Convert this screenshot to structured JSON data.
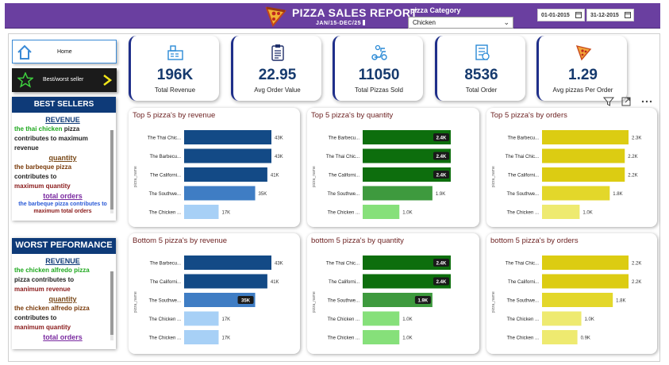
{
  "header": {
    "title": "PIZZA SALES REPORT",
    "subtitle": "JAN/15-DEC/25",
    "category_label": "pizza Category",
    "category_value": "Chicken",
    "date_start": "01-01-2015",
    "date_end": "31-12-2015"
  },
  "nav": {
    "home_label": "Home",
    "best_worst_label": "Best/worst seller"
  },
  "best_sellers": {
    "title": "BEST SELLERS",
    "revenue_title": "REVENUE",
    "revenue_l1": "the thai chicken",
    "revenue_l1b": " pizza",
    "revenue_l2": "contributes to maximum",
    "revenue_l3": "revenue",
    "quantity_title": "quantity",
    "quantity_l1": "the barbeque pizza",
    "quantity_l2": "contributes to",
    "quantity_l3": "maximum quantity",
    "orders_title": "total orders",
    "orders_l1": "the barbeque pizza contributes to",
    "orders_l2": "maximum total orders"
  },
  "worst": {
    "title": "WORST PEFORMANCE",
    "revenue_title": "REVENUE",
    "revenue_l1": "the chicken alfredo pizza",
    "revenue_l2": "pizza contributes to",
    "revenue_l3": "manimum revenue",
    "quantity_title": "quantity",
    "quantity_l1": "the chicken alfredo pizza",
    "quantity_l2": "contributes to",
    "quantity_l3": "manimum quantity",
    "orders_title": "total orders"
  },
  "kpis": [
    {
      "value": "196K",
      "label": "Total Revenue",
      "icon": "cash-register-icon"
    },
    {
      "value": "22.95",
      "label": "Avg Order Value",
      "icon": "clipboard-icon"
    },
    {
      "value": "11050",
      "label": "Total Pizzas Sold",
      "icon": "delivery-scooter-icon"
    },
    {
      "value": "8536",
      "label": "Total Order",
      "icon": "order-list-icon"
    },
    {
      "value": "1.29",
      "label": "Avg pizzas Per Order",
      "icon": "pizza-slice-icon"
    }
  ],
  "colors": {
    "header_bg": "#6a3fa0",
    "side_head": "#0e3a78",
    "kpi_value": "#163a6e",
    "chart_title": "#6b1f1f"
  },
  "chart_data": [
    {
      "type": "bar",
      "orientation": "horizontal",
      "title": "Top 5 pizza's by revenue",
      "ylabel": "pizza_name",
      "categories": [
        "The Thai Chic...",
        "The Barbecu...",
        "The Californi...",
        "The Southwe...",
        "The Chicken ..."
      ],
      "values": [
        43000,
        43000,
        41000,
        35000,
        17000
      ],
      "labels": [
        "43K",
        "43K",
        "41K",
        "35K",
        "17K"
      ],
      "colors": [
        "#134a86",
        "#134a86",
        "#134a86",
        "#3f7dc4",
        "#a7d0f6"
      ],
      "xlim": [
        0,
        43000
      ]
    },
    {
      "type": "bar",
      "orientation": "horizontal",
      "title": "Top 5 pizza's by quantity",
      "ylabel": "pizza_name",
      "categories": [
        "The Barbecu...",
        "The Thai Chic...",
        "The Californi...",
        "The Southwe...",
        "The Chicken ..."
      ],
      "values": [
        2400,
        2400,
        2400,
        1900,
        1000
      ],
      "labels": [
        "2.4K",
        "2.4K",
        "2.4K",
        "1.9K",
        "1.0K"
      ],
      "colors": [
        "#0d6e0d",
        "#0d6e0d",
        "#0d6e0d",
        "#3e9a3e",
        "#86e07a"
      ],
      "xlim": [
        0,
        2400
      ]
    },
    {
      "type": "bar",
      "orientation": "horizontal",
      "title": "Top 5 pizza's by orders",
      "ylabel": "pizza_name",
      "categories": [
        "The Barbecu...",
        "The Thai Chic...",
        "The Californi...",
        "The Southwe...",
        "The Chicken ..."
      ],
      "values": [
        2300,
        2200,
        2200,
        1800,
        1000
      ],
      "labels": [
        "2.3K",
        "2.2K",
        "2.2K",
        "1.8K",
        "1.0K"
      ],
      "colors": [
        "#dccc12",
        "#dccc12",
        "#dccc12",
        "#e3d72a",
        "#eeea70"
      ],
      "xlim": [
        0,
        2300
      ]
    },
    {
      "type": "bar",
      "orientation": "horizontal",
      "title": "Bottom 5 pizza's by revenue",
      "ylabel": "pizza_name",
      "categories": [
        "The Barbecu...",
        "The Californi...",
        "The Southwe...",
        "The Chicken ...",
        "The Chicken ..."
      ],
      "values": [
        43000,
        41000,
        35000,
        17000,
        17000
      ],
      "labels": [
        "43K",
        "41K",
        "35K",
        "17K",
        "17K"
      ],
      "colors": [
        "#134a86",
        "#134a86",
        "#3f7dc4",
        "#a7d0f6",
        "#a7d0f6"
      ],
      "xlim": [
        0,
        43000
      ]
    },
    {
      "type": "bar",
      "orientation": "horizontal",
      "title": "bottom 5 pizza's by quantity",
      "ylabel": "pizza_name",
      "categories": [
        "The Thai Chic...",
        "The Californi...",
        "The Southwe...",
        "The Chicken ...",
        "The Chicken ..."
      ],
      "values": [
        2400,
        2400,
        1900,
        1000,
        1000
      ],
      "labels": [
        "2.4K",
        "2.4K",
        "1.9K",
        "1.0K",
        "1.0K"
      ],
      "colors": [
        "#0d6e0d",
        "#0d6e0d",
        "#3e9a3e",
        "#86e07a",
        "#86e07a"
      ],
      "xlim": [
        0,
        2400
      ]
    },
    {
      "type": "bar",
      "orientation": "horizontal",
      "title": "bottom 5 pizza's by orders",
      "ylabel": "pizza_name",
      "categories": [
        "The Thai Chic...",
        "The Californi...",
        "The Southwe...",
        "The Chicken ...",
        "The Chicken ..."
      ],
      "values": [
        2200,
        2200,
        1800,
        1000,
        900
      ],
      "labels": [
        "2.2K",
        "2.2K",
        "1.8K",
        "1.0K",
        "0.9K"
      ],
      "colors": [
        "#dccc12",
        "#dccc12",
        "#e3d72a",
        "#eeea70",
        "#eeea70"
      ],
      "xlim": [
        0,
        2200
      ]
    }
  ]
}
